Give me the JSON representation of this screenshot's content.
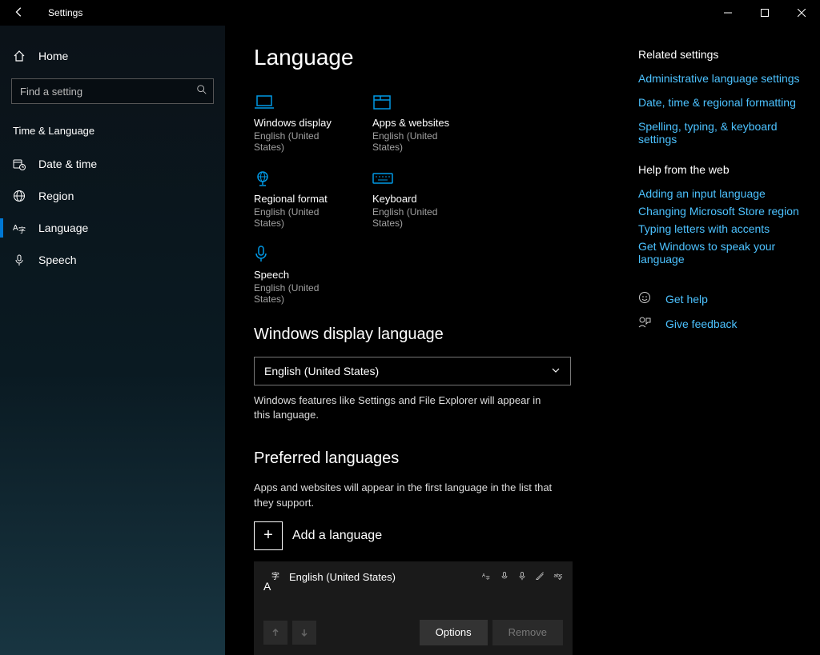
{
  "window": {
    "title": "Settings"
  },
  "sidebar": {
    "home": "Home",
    "search_placeholder": "Find a setting",
    "header": "Time & Language",
    "items": [
      {
        "label": "Date & time"
      },
      {
        "label": "Region"
      },
      {
        "label": "Language"
      },
      {
        "label": "Speech"
      }
    ]
  },
  "page": {
    "title": "Language",
    "tiles": [
      {
        "label": "Windows display",
        "sub": "English (United States)"
      },
      {
        "label": "Apps & websites",
        "sub": "English (United States)"
      },
      {
        "label": "Regional format",
        "sub": "English (United States)"
      },
      {
        "label": "Keyboard",
        "sub": "English (United States)"
      },
      {
        "label": "Speech",
        "sub": "English (United States)"
      }
    ],
    "display_lang_header": "Windows display language",
    "display_lang_value": "English (United States)",
    "display_lang_help": "Windows features like Settings and File Explorer will appear in this language.",
    "preferred_header": "Preferred languages",
    "preferred_help": "Apps and websites will appear in the first language in the list that they support.",
    "add_language": "Add a language",
    "lang_entry": "English (United States)",
    "options_btn": "Options",
    "remove_btn": "Remove"
  },
  "right": {
    "related_header": "Related settings",
    "related_links": [
      "Administrative language settings",
      "Date, time & regional formatting",
      "Spelling, typing, & keyboard settings"
    ],
    "help_header": "Help from the web",
    "help_links": [
      "Adding an input language",
      "Changing Microsoft Store region",
      "Typing letters with accents",
      "Get Windows to speak your language"
    ],
    "get_help": "Get help",
    "give_feedback": "Give feedback"
  }
}
